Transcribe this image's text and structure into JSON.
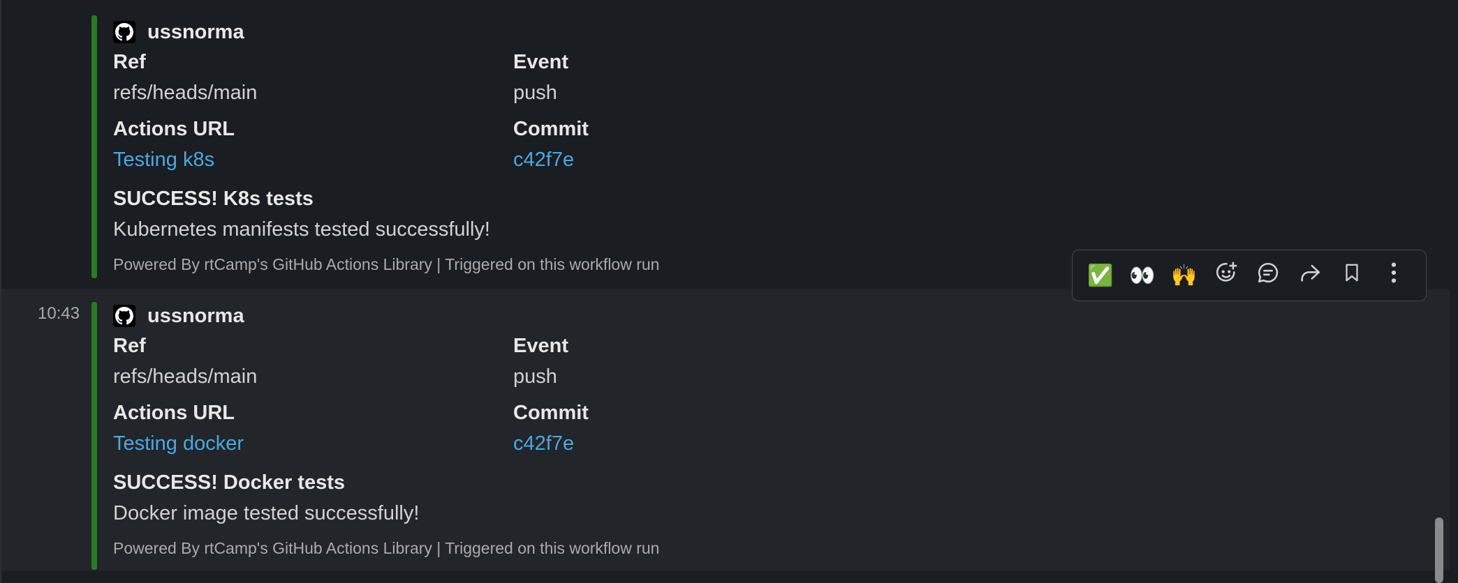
{
  "messages": [
    {
      "time": "",
      "author": "ussnorma",
      "fields": [
        {
          "label": "Ref",
          "value": "refs/heads/main",
          "link": false
        },
        {
          "label": "Event",
          "value": "push",
          "link": false
        },
        {
          "label": "Actions URL",
          "value": "Testing k8s",
          "link": true
        },
        {
          "label": "Commit",
          "value": "c42f7e",
          "link": true
        }
      ],
      "title": "SUCCESS! K8s tests",
      "text": "Kubernetes manifests tested successfully!",
      "footer": "Powered By rtCamp's GitHub Actions Library | Triggered on this workflow run"
    },
    {
      "time": "10:43",
      "author": "ussnorma",
      "fields": [
        {
          "label": "Ref",
          "value": "refs/heads/main",
          "link": false
        },
        {
          "label": "Event",
          "value": "push",
          "link": false
        },
        {
          "label": "Actions URL",
          "value": "Testing docker",
          "link": true
        },
        {
          "label": "Commit",
          "value": "c42f7e",
          "link": true
        }
      ],
      "title": "SUCCESS! Docker tests",
      "text": "Docker image tested successfully!",
      "footer": "Powered By rtCamp's GitHub Actions Library | Triggered on this workflow run"
    }
  ],
  "toolbar": {
    "emoji_check": "✅",
    "emoji_eyes": "👀",
    "emoji_raised_hands": "🙌",
    "icons": [
      "add-reaction-icon",
      "reply-in-thread-icon",
      "share-icon",
      "save-bookmark-icon",
      "more-actions-icon"
    ]
  },
  "colors": {
    "background": "#1a1d21",
    "hover_background": "#222529",
    "attachment_bar": "#2a7b24",
    "link": "#4ea7df"
  }
}
